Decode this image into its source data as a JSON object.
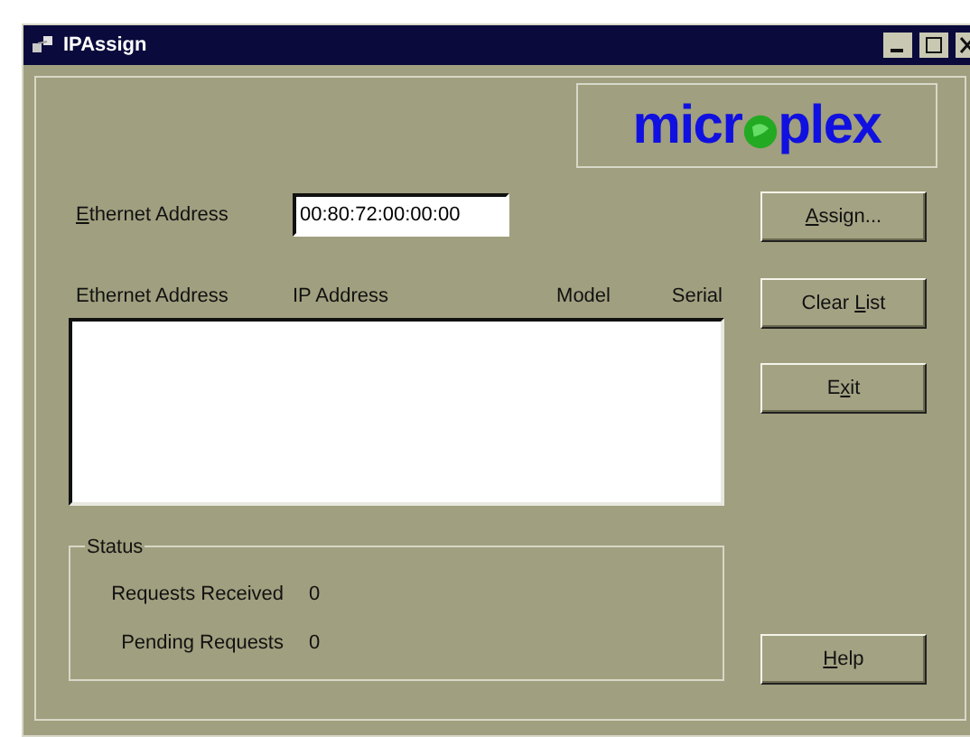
{
  "window": {
    "title": "IPAssign"
  },
  "logo": {
    "text_left": "micr",
    "text_right": "plex"
  },
  "ethernet_field": {
    "label": "Ethernet Address",
    "value": "00:80:72:00:00:00"
  },
  "buttons": [
    {
      "label": "Assign..."
    },
    {
      "label": "Clear List"
    },
    {
      "label": "Exit"
    },
    {
      "label": "Help"
    }
  ],
  "table": {
    "columns": [
      "Ethernet Address",
      "IP Address",
      "Model",
      "Serial"
    ]
  },
  "status": {
    "title": "Status",
    "rows": [
      {
        "label": "Requests Received",
        "value": "0"
      },
      {
        "label": "Pending Requests",
        "value": "0"
      }
    ]
  }
}
